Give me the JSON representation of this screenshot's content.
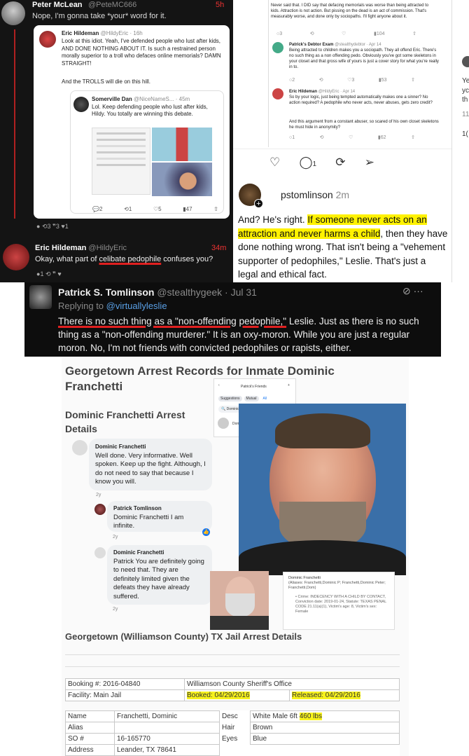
{
  "p1": {
    "name": "Peter McLean",
    "handle": "@PeteMC666",
    "time": "5h",
    "text": "Nope, I'm gonna take *your* word for it.",
    "quote": {
      "name": "Eric Hildeman",
      "handle": "@HildyEric · 16h",
      "text": "Look at this idiot. Yeah, I've defended people who lust after kids, AND DONE NOTHING ABOUT IT. Is such a restrained person morally superior to a troll who defaces online memorials? DAMN STRAIGHT!",
      "text2": "And the TROLLS will die on this hill.",
      "inner": {
        "name": "Somerville Dan",
        "handle": "@NiceNameS... · 45m",
        "text": "Lol. Keep defending people who lust after kids, Hildy. You totally are winning this debate."
      },
      "stats": {
        "replies": "2",
        "retweets": "1",
        "likes": "5",
        "views": "47"
      }
    },
    "actions": {
      "retweets": "3",
      "quotes": "3",
      "likes": "1"
    },
    "reply": {
      "name": "Eric Hildeman",
      "handle": "@HildyEric",
      "time": "34m",
      "text_a": "Okay, what part of ",
      "text_ul": "celibate pedophile",
      "text_b": " confuses you?",
      "actions": {
        "replies": "1"
      }
    }
  },
  "p2": {
    "tweet1": "Never said that. I DID say that defacing memorials was worse than being attracted to kids. Attraction is not action. But pissing on the dead is an act of commission. That's measurably worse, and done only by sociopaths. I'll fight anyone about it.",
    "stats1": {
      "replies": "3",
      "views": "104"
    },
    "tweet2": {
      "name": "Patrick's Debtor Exam",
      "handle": "@stealthydebtor · Apr 14",
      "text": "Being attracted to children makes you a sociopath. They all offend Eric. There's no such thing as a non offending pedo. Obviously you've got some skeletons in your closet and that gross wife of yours is just a cover story for what you're really in to.",
      "replies": "2",
      "retweets": "3",
      "views": "53"
    },
    "tweet3": {
      "name": "Eric Hildeman",
      "handle": "@HildyEric · Apr 14",
      "text": "So by your logic, just being tempted automatically makes one a sinner? No action required? A pedophile who never acts, never abuses, gets zero credit?",
      "text2": "And this argument from a constant abuser, so scared of his own closet skeletons he must hide in anonymity?",
      "replies": "1",
      "views": "62"
    },
    "reply_count": "1",
    "post": {
      "user": "pstomlinson",
      "time": "2m",
      "t1": "And? He's right. ",
      "h1": "If someone never acts on an",
      "h2": "attraction and never harms a child",
      "t2": ", then they have done nothing wrong. That isn't being a \"vehement supporter of pedophiles,\" Leslie. That's just a legal and ethical fact."
    },
    "edge": {
      "a": "Ye",
      "b": "yc",
      "c": "th",
      "d": "11",
      "e": "1("
    }
  },
  "p3": {
    "name": "Patrick S. Tomlinson",
    "handle": "@stealthygeek · Jul 31",
    "replying": "Replying to ",
    "reply_to": "@virtuallyleslie",
    "ul": "There is no such thing as a \"non-offending pedophile,\"",
    "text": " Leslie. Just as there is no such thing as a \"non-offending murderer.\" It is an oxy-moron. While you are just a regular moron. No, I'm not friends with convicted pedophiles or rapists, either."
  },
  "p4": {
    "title": "Georgetown Arrest Records for Inmate Dominic Franchetti",
    "subtitle": "Dominic Franchetti Arrest Details",
    "fb": {
      "title": "Patrick's Friends",
      "tabs": [
        "Suggestions",
        "Mutual",
        "All"
      ],
      "search": "Dominic Franchetti",
      "result": "Dominic Franchetti"
    },
    "c1": {
      "name": "Dominic Franchetti",
      "text": "Well done. Very informative. Well spoken. Keep up the fight. Although, I do not need to say that because I know you will.",
      "age": "2y"
    },
    "c2": {
      "name": "Patrick Tomlinson",
      "text": "Dominic Franchetti I am infinite.",
      "age": "2y"
    },
    "c3": {
      "name": "Dominic Franchetti",
      "text": "Patrick You are definitely going to need that. They are definitely limited given the defeats they have already suffered.",
      "age": "2y"
    },
    "card": {
      "name": "Dominic Franchetti",
      "aliases": "(Aliases: Franchetti,Dominic P; Franchetti,Dominic Peter; Franchetti,Dom)",
      "crime": "Crime: INDECENCY WITH A CHILD BY CONTACT, Conviction date: 2019-01-24, Statute: TEXAS PENAL CODE 21.11(a)(1), Victim's age: 8, Victim's sex: Female"
    },
    "section": "Georgetown (Williamson County) TX Jail Arrest Details",
    "booking": {
      "num": "Booking #: 2016-04840",
      "facility": "Facility: Main Jail",
      "agency": "Williamson County Sheriff's Office",
      "booked": "Booked: 04/29/2016",
      "released": "Released: 04/29/2016"
    },
    "details": {
      "name_l": "Name",
      "name_v": "Franchetti, Dominic",
      "alias_l": "Alias",
      "alias_v": "",
      "so_l": "SO #",
      "so_v": "16-165770",
      "addr_l": "Address",
      "addr_v": "Leander, TX 78641",
      "desc_l": "Desc",
      "desc_v": "White  Male  6ft ",
      "weight": "460 lbs",
      "hair_l": "Hair",
      "hair_v": "Brown",
      "eyes_l": "Eyes",
      "eyes_v": "Blue"
    }
  }
}
